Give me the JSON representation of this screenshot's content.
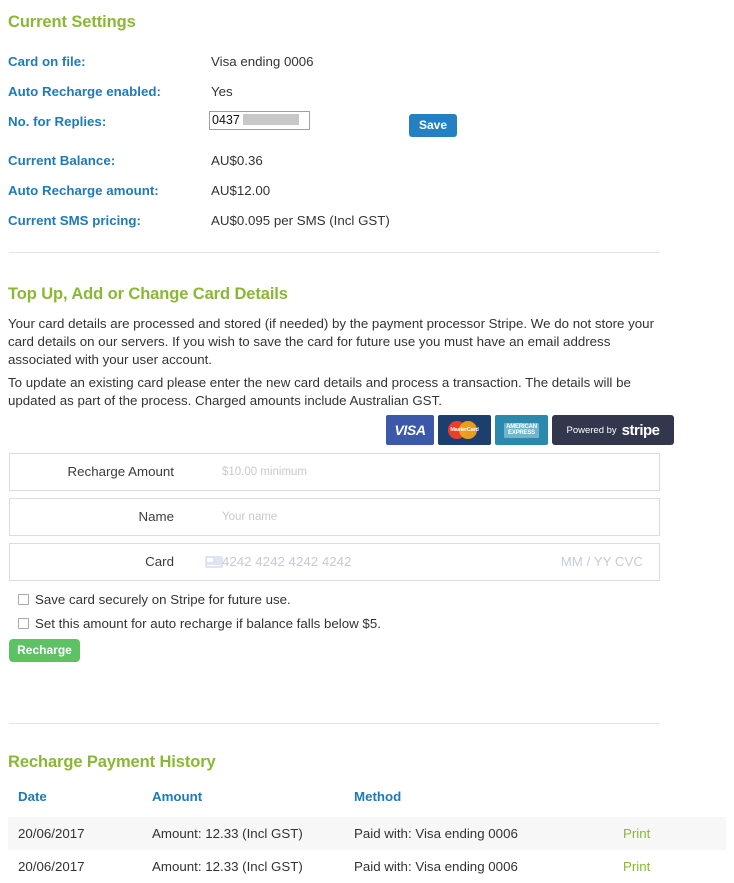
{
  "current_settings": {
    "heading": "Current Settings",
    "rows": [
      {
        "label": "Card on file:",
        "value": "Visa ending 0006"
      },
      {
        "label": "Auto Recharge enabled:",
        "value": "Yes"
      },
      {
        "label": "No. for Replies:",
        "value": ""
      },
      {
        "label": "Current Balance:",
        "value": "AU$0.36"
      },
      {
        "label": "Auto Recharge amount:",
        "value": "AU$12.00"
      },
      {
        "label": "Current SMS pricing:",
        "value": "AU$0.095 per SMS (Incl GST)"
      }
    ],
    "reply_number_input": {
      "value": "0437 ",
      "redacted": true
    },
    "save_label": "Save"
  },
  "topup": {
    "heading": "Top Up, Add or Change Card Details",
    "paragraph_1": "Your card details are processed and stored (if needed) by the payment processor Stripe. We do not store your card details on our servers. If you wish to save the card for future use you must have an email address associated with your user account.",
    "paragraph_2": "To update an existing card please enter the new card details and process a transaction. The details will be updated as part of the process. Charged amounts include Australian GST.",
    "logos": [
      {
        "name": "visa-logo",
        "text": "VISA"
      },
      {
        "name": "mastercard-logo",
        "text": "MasterCard"
      },
      {
        "name": "amex-logo",
        "line1": "AMERICAN",
        "line2": "EXPRESS"
      },
      {
        "name": "stripe-logo",
        "prefix": "Powered by",
        "wordmark": "stripe"
      }
    ],
    "fields": [
      {
        "label": "Recharge Amount",
        "placeholder": "$10.00 minimum",
        "value": ""
      },
      {
        "label": "Name",
        "placeholder": "Your name",
        "value": ""
      },
      {
        "label": "Card",
        "placeholder": "4242 4242 4242 4242",
        "value": "",
        "expiry_cvc": "MM / YY  CVC"
      }
    ],
    "checkboxes": [
      {
        "label": "Save card securely on Stripe for future use.",
        "checked": false
      },
      {
        "label": "Set this amount for auto recharge if balance falls below $5.",
        "checked": false
      }
    ],
    "recharge_label": "Recharge"
  },
  "history": {
    "heading": "Recharge Payment History",
    "columns": [
      "Date",
      "Amount",
      "Method",
      ""
    ],
    "rows": [
      {
        "date": "20/06/2017",
        "amount": "Amount: 12.33 (Incl GST)",
        "method": "Paid with: Visa ending 0006",
        "action": "Print"
      },
      {
        "date": "20/06/2017",
        "amount": "Amount: 12.33 (Incl GST)",
        "method": "Paid with: Visa ending 0006",
        "action": "Print"
      }
    ]
  },
  "colors": {
    "heading_green": "#8ab833",
    "label_blue": "#1f7ab8",
    "save_blue": "#2580c3",
    "recharge_green": "#5dc264",
    "link_green": "#8ab833",
    "row_stripe": "#f7f7f7"
  }
}
